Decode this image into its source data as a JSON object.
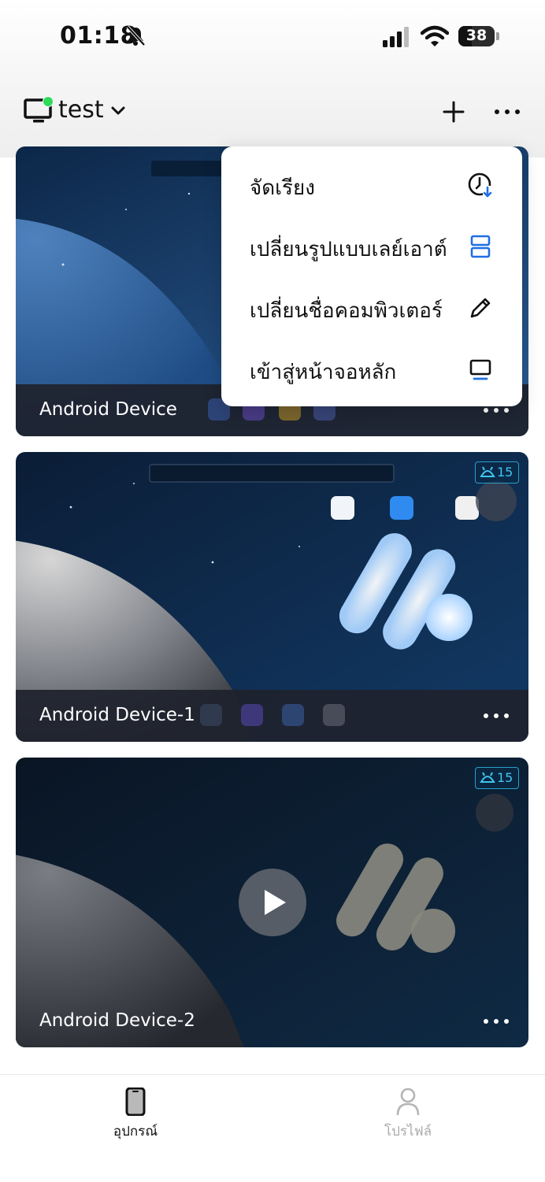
{
  "status_bar": {
    "time": "01:18",
    "battery": "38",
    "battery_level": 0.38
  },
  "header": {
    "device_group": "test"
  },
  "menu": {
    "items": [
      {
        "label": "จัดเรียง",
        "icon": "sort-clock-icon"
      },
      {
        "label": "เปลี่ยนรูปแบบเลย์เอาต์",
        "icon": "layout-icon"
      },
      {
        "label": "เปลี่ยนชื่อคอมพิวเตอร์",
        "icon": "pencil-icon"
      },
      {
        "label": "เข้าสู่หน้าจอหลัก",
        "icon": "monitor-icon"
      }
    ]
  },
  "devices": [
    {
      "name": "Android Device",
      "state": "running"
    },
    {
      "name": "Android Device-1",
      "state": "running",
      "android_badge": "15"
    },
    {
      "name": "Android Device-2",
      "state": "stopped",
      "android_badge": "15"
    }
  ],
  "tabs": [
    {
      "label": "อุปกรณ์",
      "icon": "phone-icon",
      "active": true
    },
    {
      "label": "โปรไฟล์",
      "icon": "person-icon",
      "active": false
    }
  ],
  "colors": {
    "accent": "#1f6fe5",
    "online": "#2fd95a",
    "badge": "#3fc6ef"
  }
}
